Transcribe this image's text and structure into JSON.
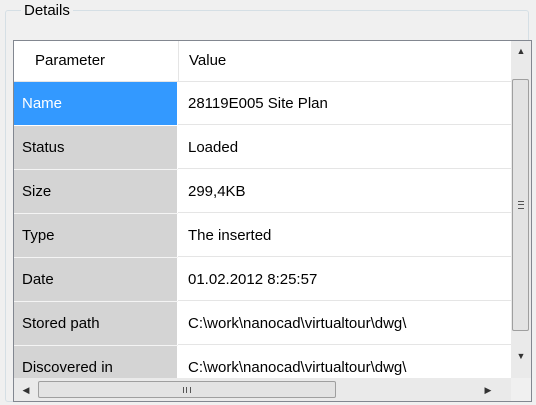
{
  "group": {
    "title": "Details"
  },
  "table": {
    "columns": [
      "Parameter",
      "Value"
    ],
    "rows": [
      {
        "name": "Name",
        "value": "28119E005 Site Plan",
        "selected": true
      },
      {
        "name": "Status",
        "value": "Loaded"
      },
      {
        "name": "Size",
        "value": "299,4KB"
      },
      {
        "name": "Type",
        "value": "The inserted"
      },
      {
        "name": "Date",
        "value": "01.02.2012 8:25:57"
      },
      {
        "name": "Stored path",
        "value": "C:\\work\\nanocad\\virtualtour\\dwg\\"
      },
      {
        "name": "Discovered in",
        "value": "C:\\work\\nanocad\\virtualtour\\dwg\\"
      }
    ]
  },
  "scrollbars": {
    "vertical_arrow_up": "▲",
    "vertical_arrow_down": "▼",
    "horizontal_arrow_left": "◀",
    "horizontal_arrow_right": "▶"
  }
}
